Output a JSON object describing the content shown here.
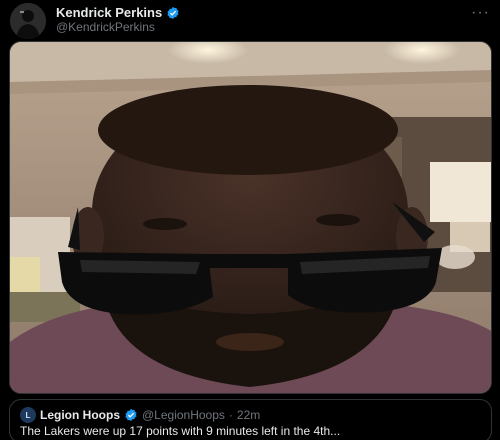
{
  "tweet": {
    "author_name": "Kendrick Perkins",
    "author_handle": "@KendrickPerkins",
    "more_icon": "more-horizontal-icon",
    "media_alt": "selfie-photo"
  },
  "quote": {
    "author_name": "Legion Hoops",
    "author_handle": "@LegionHoops",
    "dot": "·",
    "time": "22m",
    "text": "The Lakers were up 17 points with 9 minutes left in the 4th..."
  },
  "colors": {
    "background": "#000000",
    "primary_text": "#e7e9ea",
    "secondary_text": "#71767b",
    "verified_blue": "#1d9bf0",
    "border": "#2f3336"
  }
}
